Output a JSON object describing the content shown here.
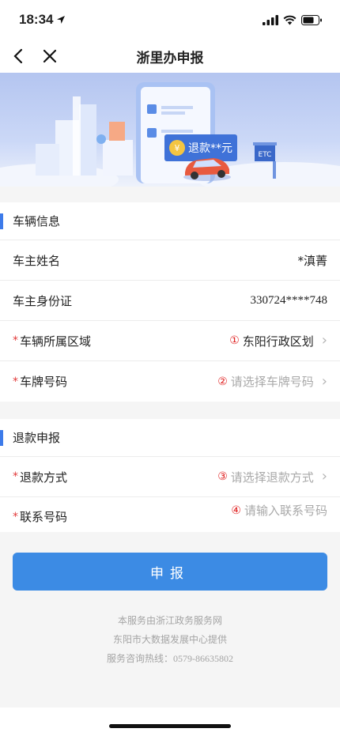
{
  "status_bar": {
    "time": "18:34"
  },
  "nav": {
    "title": "浙里办申报"
  },
  "banner": {
    "refund_text": "退款**元",
    "etc_text": "ETC"
  },
  "vehicle_section": {
    "title": "车辆信息",
    "owner_name_label": "车主姓名",
    "owner_name_value": "*滇菁",
    "owner_id_label": "车主身份证",
    "owner_id_value": "330724****748",
    "region_label": "车辆所属区域",
    "region_badge": "①",
    "region_value": "东阳行政区划",
    "plate_label": "车牌号码",
    "plate_badge": "②",
    "plate_placeholder": "请选择车牌号码"
  },
  "refund_section": {
    "title": "退款申报",
    "method_label": "退款方式",
    "method_badge": "③",
    "method_placeholder": "请选择退款方式",
    "phone_label": "联系号码",
    "phone_badge": "④",
    "phone_placeholder": "请输入联系号码"
  },
  "submit": {
    "label": "申报"
  },
  "footer": {
    "line1": "本服务由浙江政务服务网",
    "line2": "东阳市大数据发展中心提供",
    "line3": "服务咨询热线：0579-86635802"
  },
  "colors": {
    "accent": "#3d7bea",
    "button": "#3c8be4",
    "required": "#e23b3b",
    "badge": "#e02020"
  }
}
